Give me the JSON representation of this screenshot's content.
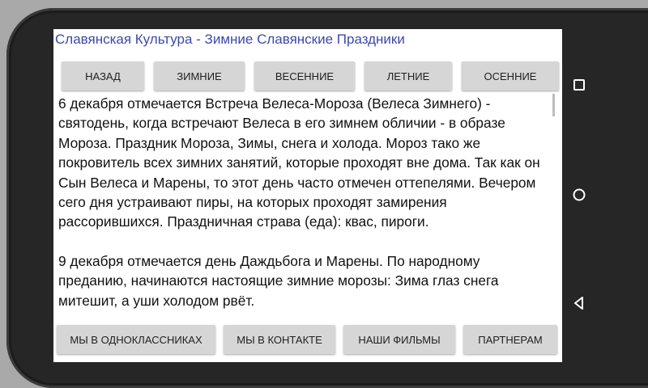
{
  "app": {
    "title": "Славянская Культура - Зимние Славянские Праздники"
  },
  "top_nav": [
    {
      "label": "НАЗАД"
    },
    {
      "label": "ЗИМНИЕ"
    },
    {
      "label": "ВЕСЕННИЕ"
    },
    {
      "label": "ЛЕТНИЕ"
    },
    {
      "label": "ОСЕННИЕ"
    }
  ],
  "content": {
    "paragraphs": [
      "6 декабря отмечается Встреча Велеса-Мороза (Велеса Зимнего) - святодень, когда встречают Велеса в его зимнем обличии - в образе Мороза. Праздник Мороза, Зимы, снега и холода. Мороз тако же покровитель всех зимних занятий, которые проходят вне дома. Так как он Сын Велеса и Марены, то этот день часто отмечен оттепелями. Вечером сего дня устраивают пиры, на которых проходят замирения рассорившихся. Праздничная страва (еда): квас, пироги.",
      " 9 декабря отмечается день Даждьбога и Марены. По народному преданию, начинаются настоящие зимние морозы: Зима глаз снега митешит, а уши холодом рвёт."
    ]
  },
  "bottom_nav": [
    {
      "label": "МЫ В ОДНОКЛАССНИКАХ"
    },
    {
      "label": "МЫ В КОНТАКТЕ"
    },
    {
      "label": "НАШИ ФИЛЬМЫ"
    },
    {
      "label": "ПАРТНЕРАМ"
    }
  ],
  "system_nav": {
    "icons": [
      "recents-square-icon",
      "home-circle-icon",
      "back-triangle-icon"
    ]
  }
}
